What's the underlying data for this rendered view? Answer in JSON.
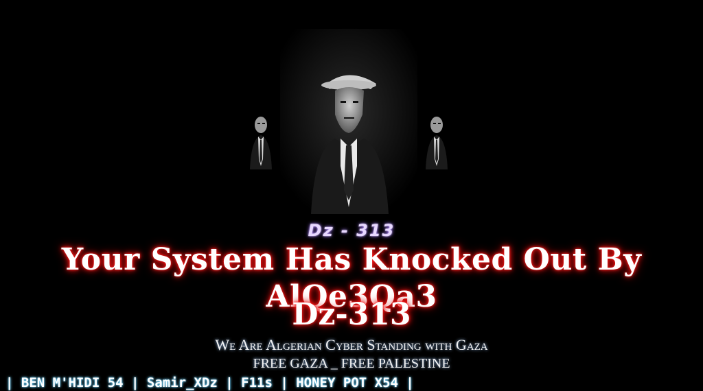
{
  "hero": {
    "image_name": "three-men-in-suits-image"
  },
  "logo_text": "Dz - 313",
  "headline": {
    "line1": "Your System Has Knocked Out By AlQe3Qa3",
    "line2": "Dz-313"
  },
  "subtitle": {
    "line1": "We Are Algerian Cyber Standing with Gaza",
    "line2": "FREE GAZA _ FREE PALESTINE"
  },
  "credits": "| BEN M'HIDI 54 | Samir_XDz | F11s | HONEY POT X54 |",
  "colors": {
    "background": "#000000",
    "headline_glow": "#ff1a1a",
    "subtitle_glow": "#9ec8ff",
    "credits_glow": "#6fd3ff"
  }
}
